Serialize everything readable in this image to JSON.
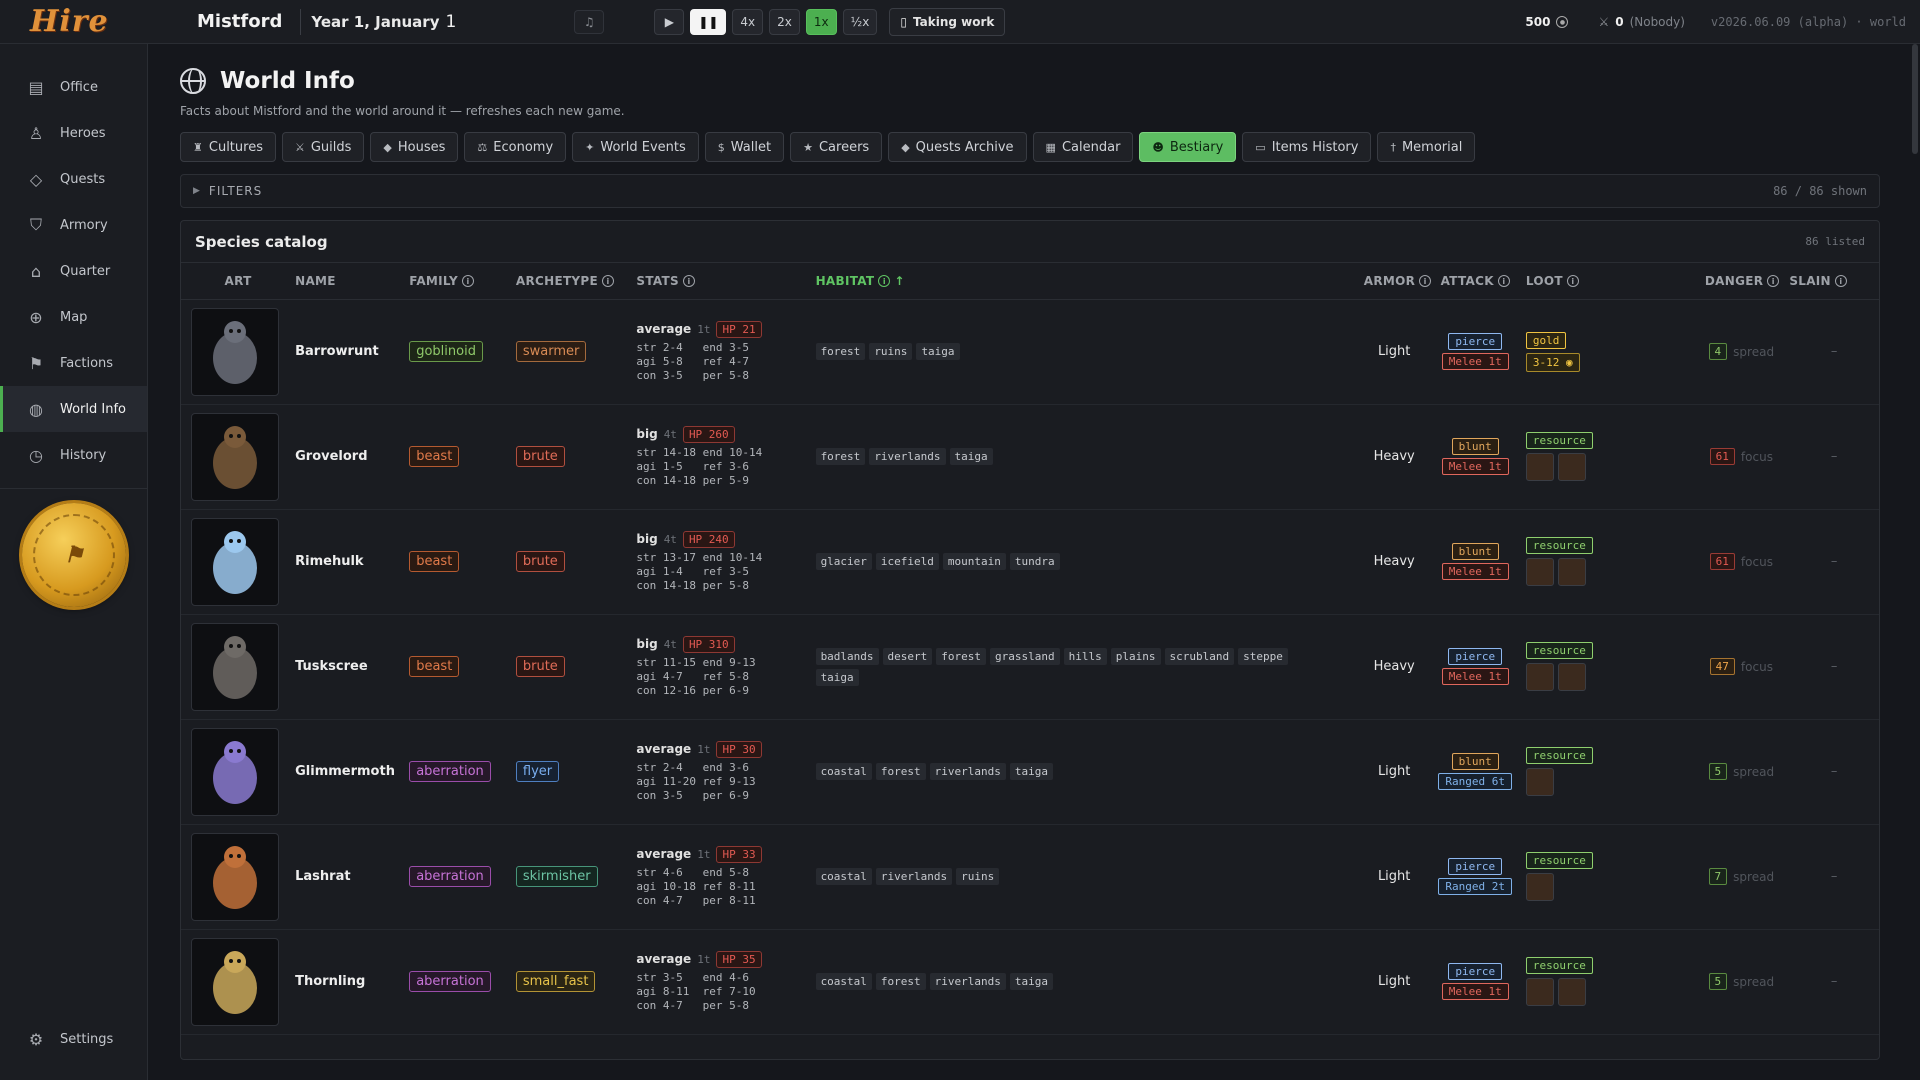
{
  "app": {
    "logo": "Hire",
    "town": "Mistford",
    "date": "Year 1, January",
    "day": "1"
  },
  "controls": {
    "play": "▶",
    "pause": "❚❚",
    "speeds": [
      "4x",
      "2x",
      "1x",
      "½x"
    ],
    "active_speed": "1x",
    "work": "Taking work"
  },
  "status": {
    "gold": "500",
    "heroes": "0",
    "nobody": "(Nobody)",
    "version": "v2026.06.09 (alpha) · world"
  },
  "sidebar": {
    "items": [
      {
        "label": "Office",
        "icon": "office-icon"
      },
      {
        "label": "Heroes",
        "icon": "heroes-icon"
      },
      {
        "label": "Quests",
        "icon": "quests-icon"
      },
      {
        "label": "Armory",
        "icon": "armory-icon"
      },
      {
        "label": "Quarter",
        "icon": "quarter-icon"
      },
      {
        "label": "Map",
        "icon": "map-icon"
      },
      {
        "label": "Factions",
        "icon": "factions-icon"
      },
      {
        "label": "World Info",
        "icon": "globe-icon"
      },
      {
        "label": "History",
        "icon": "history-icon"
      }
    ],
    "settings": "Settings",
    "active": "World Info"
  },
  "page": {
    "title": "World Info",
    "subtitle": "Facts about Mistford and the world around it — refreshes each new game."
  },
  "tabs": [
    {
      "label": "Cultures",
      "icon": "♜"
    },
    {
      "label": "Guilds",
      "icon": "⚔"
    },
    {
      "label": "Houses",
      "icon": "◆"
    },
    {
      "label": "Economy",
      "icon": "⚖"
    },
    {
      "label": "World Events",
      "icon": "✦"
    },
    {
      "label": "Wallet",
      "icon": "$"
    },
    {
      "label": "Careers",
      "icon": "★"
    },
    {
      "label": "Quests Archive",
      "icon": "◆"
    },
    {
      "label": "Calendar",
      "icon": "▦"
    },
    {
      "label": "Bestiary",
      "icon": "☻"
    },
    {
      "label": "Items History",
      "icon": "▭"
    },
    {
      "label": "Memorial",
      "icon": "†"
    }
  ],
  "active_tab": "Bestiary",
  "filters": {
    "label": "FILTERS",
    "shown": "86 / 86 shown"
  },
  "catalog": {
    "title": "Species catalog",
    "count": "86 listed",
    "columns": [
      "ART",
      "NAME",
      "FAMILY",
      "ARCHETYPE",
      "STATS",
      "HABITAT",
      "ARMOR",
      "ATTACK",
      "LOOT",
      "DANGER",
      "SLAIN"
    ],
    "rows": [
      {
        "name": "Barrowrunt",
        "family": "goblinoid",
        "archetype": "swarmer",
        "size": "average",
        "tiles": "1t",
        "hp": "HP 21",
        "stats": [
          "str 2-4   end 3-5",
          "agi 5-8   ref 4-7",
          "con 3-5   per 5-8"
        ],
        "habitat": [
          "forest",
          "ruins",
          "taiga"
        ],
        "armor": "Light",
        "damage": "pierce",
        "range": "Melee 1t",
        "loot": "gold",
        "loot_range": "3-12",
        "items": 0,
        "danger": "4",
        "danger_level": "low",
        "mode": "spread",
        "slain": "–"
      },
      {
        "name": "Grovelord",
        "family": "beast",
        "archetype": "brute",
        "size": "big",
        "tiles": "4t",
        "hp": "HP 260",
        "stats": [
          "str 14-18 end 10-14",
          "agi 1-5   ref 3-6",
          "con 14-18 per 5-9"
        ],
        "habitat": [
          "forest",
          "riverlands",
          "taiga"
        ],
        "armor": "Heavy",
        "damage": "blunt",
        "range": "Melee 1t",
        "loot": "resource",
        "loot_range": "",
        "items": 2,
        "danger": "61",
        "danger_level": "high",
        "mode": "focus",
        "slain": "–"
      },
      {
        "name": "Rimehulk",
        "family": "beast",
        "archetype": "brute",
        "size": "big",
        "tiles": "4t",
        "hp": "HP 240",
        "stats": [
          "str 13-17 end 10-14",
          "agi 1-4   ref 3-5",
          "con 14-18 per 5-8"
        ],
        "habitat": [
          "glacier",
          "icefield",
          "mountain",
          "tundra"
        ],
        "armor": "Heavy",
        "damage": "blunt",
        "range": "Melee 1t",
        "loot": "resource",
        "loot_range": "",
        "items": 2,
        "danger": "61",
        "danger_level": "high",
        "mode": "focus",
        "slain": "–"
      },
      {
        "name": "Tuskscree",
        "family": "beast",
        "archetype": "brute",
        "size": "big",
        "tiles": "4t",
        "hp": "HP 310",
        "stats": [
          "str 11-15 end 9-13",
          "agi 4-7   ref 5-8",
          "con 12-16 per 6-9"
        ],
        "habitat": [
          "badlands",
          "desert",
          "forest",
          "grassland",
          "hills",
          "plains",
          "scrubland",
          "steppe",
          "taiga"
        ],
        "armor": "Heavy",
        "damage": "pierce",
        "range": "Melee 1t",
        "loot": "resource",
        "loot_range": "",
        "items": 2,
        "danger": "47",
        "danger_level": "mid",
        "mode": "focus",
        "slain": "–"
      },
      {
        "name": "Glimmermoth",
        "family": "aberration",
        "archetype": "flyer",
        "size": "average",
        "tiles": "1t",
        "hp": "HP 30",
        "stats": [
          "str 2-4   end 3-6",
          "agi 11-20 ref 9-13",
          "con 3-5   per 6-9"
        ],
        "habitat": [
          "coastal",
          "forest",
          "riverlands",
          "taiga"
        ],
        "armor": "Light",
        "damage": "blunt",
        "range": "Ranged 6t",
        "loot": "resource",
        "loot_range": "",
        "items": 1,
        "danger": "5",
        "danger_level": "low",
        "mode": "spread",
        "slain": "–"
      },
      {
        "name": "Lashrat",
        "family": "aberration",
        "archetype": "skirmisher",
        "size": "average",
        "tiles": "1t",
        "hp": "HP 33",
        "stats": [
          "str 4-6   end 5-8",
          "agi 10-18 ref 8-11",
          "con 4-7   per 8-11"
        ],
        "habitat": [
          "coastal",
          "riverlands",
          "ruins"
        ],
        "armor": "Light",
        "damage": "pierce",
        "range": "Ranged 2t",
        "loot": "resource",
        "loot_range": "",
        "items": 1,
        "danger": "7",
        "danger_level": "low",
        "mode": "spread",
        "slain": "–"
      },
      {
        "name": "Thornling",
        "family": "aberration",
        "archetype": "small_fast",
        "size": "average",
        "tiles": "1t",
        "hp": "HP 35",
        "stats": [
          "str 3-5   end 4-6",
          "agi 8-11  ref 7-10",
          "con 4-7   per 5-8"
        ],
        "habitat": [
          "coastal",
          "forest",
          "riverlands",
          "taiga"
        ],
        "armor": "Light",
        "damage": "pierce",
        "range": "Melee 1t",
        "loot": "resource",
        "loot_range": "",
        "items": 2,
        "danger": "5",
        "danger_level": "low",
        "mode": "spread",
        "slain": "–"
      }
    ]
  }
}
